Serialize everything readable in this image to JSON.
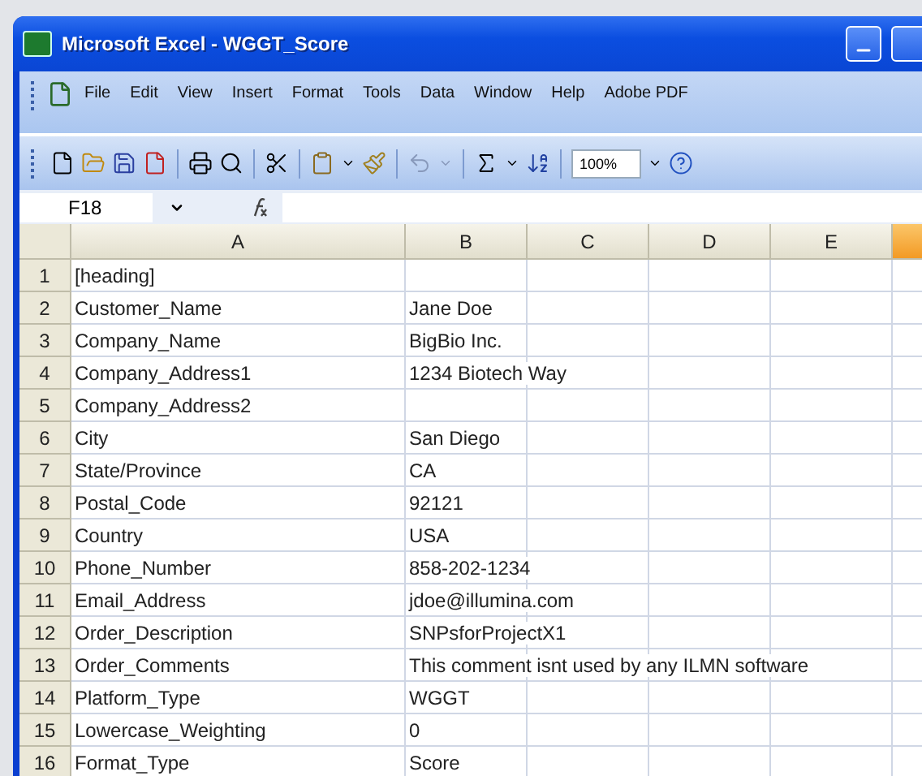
{
  "window": {
    "title": "Microsoft Excel - WGGT_Score"
  },
  "menu": [
    "File",
    "Edit",
    "View",
    "Insert",
    "Format",
    "Tools",
    "Data",
    "Window",
    "Help",
    "Adobe PDF"
  ],
  "toolbar": {
    "zoom": "100%"
  },
  "formula_bar": {
    "name_box": "F18"
  },
  "columns": [
    {
      "label": "A",
      "selected": false
    },
    {
      "label": "B",
      "selected": false
    },
    {
      "label": "C",
      "selected": false
    },
    {
      "label": "D",
      "selected": false
    },
    {
      "label": "E",
      "selected": false
    },
    {
      "selected": true
    }
  ],
  "rows": [
    {
      "number": "1",
      "a": "[heading]",
      "b": ""
    },
    {
      "number": "2",
      "a": "Customer_Name",
      "b": "Jane Doe"
    },
    {
      "number": "3",
      "a": "Company_Name",
      "b": "BigBio Inc."
    },
    {
      "number": "4",
      "a": "Company_Address1",
      "b": "1234 Biotech Way"
    },
    {
      "number": "5",
      "a": "Company_Address2",
      "b": ""
    },
    {
      "number": "6",
      "a": "City",
      "b": "San Diego"
    },
    {
      "number": "7",
      "a": "State/Province",
      "b": "CA"
    },
    {
      "number": "8",
      "a": "Postal_Code",
      "b": "92121"
    },
    {
      "number": "9",
      "a": "Country",
      "b": "USA"
    },
    {
      "number": "10",
      "a": "Phone_Number",
      "b": "858-202-1234"
    },
    {
      "number": "11",
      "a": "Email_Address",
      "b": "jdoe@illumina.com"
    },
    {
      "number": "12",
      "a": "Order_Description",
      "b": "SNPsforProjectX1"
    },
    {
      "number": "13",
      "a": "Order_Comments",
      "b": "This comment isnt used by any ILMN software"
    },
    {
      "number": "14",
      "a": "Platform_Type",
      "b": "WGGT"
    },
    {
      "number": "15",
      "a": "Lowercase_Weighting",
      "b": "0"
    },
    {
      "number": "16",
      "a": "Format_Type",
      "b": "Score"
    }
  ]
}
